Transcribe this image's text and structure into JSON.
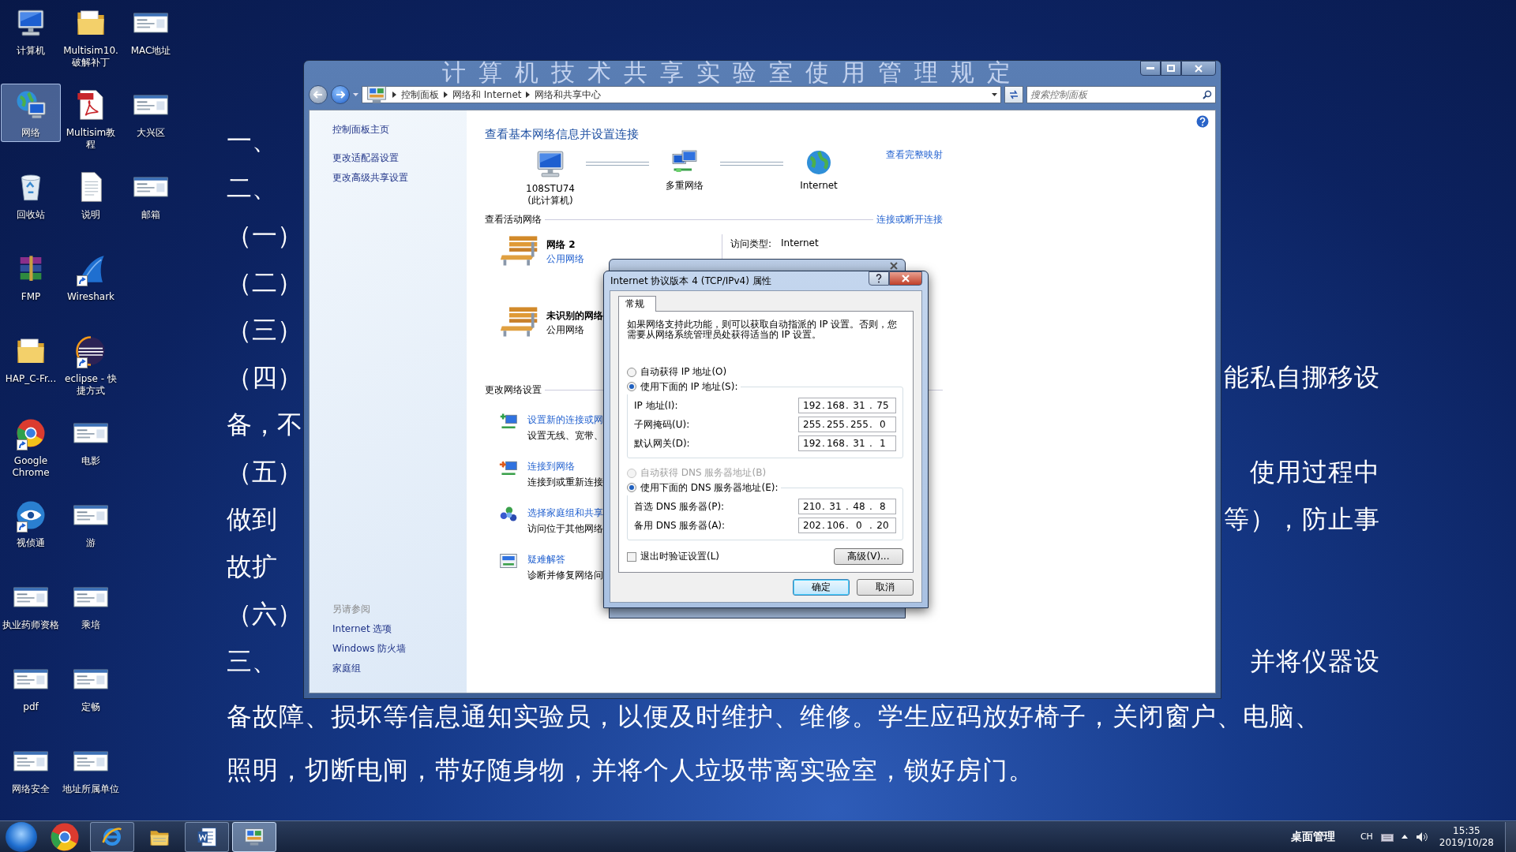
{
  "desktop_icons": [
    {
      "label": "计算机",
      "kind": "computer",
      "shortcut": false,
      "selected": false
    },
    {
      "label": "网络",
      "kind": "network",
      "shortcut": false,
      "selected": true
    },
    {
      "label": "回收站",
      "kind": "recycle",
      "shortcut": false,
      "selected": false
    },
    {
      "label": "FMP",
      "kind": "archive",
      "shortcut": false,
      "selected": false
    },
    {
      "label": "HAP_C-Fr...",
      "kind": "folder",
      "shortcut": false,
      "selected": false
    },
    {
      "label": "Google Chrome",
      "kind": "chrome",
      "shortcut": true,
      "selected": false
    },
    {
      "label": "视侦通",
      "kind": "eye",
      "shortcut": true,
      "selected": false
    },
    {
      "label": "执业药师资格",
      "kind": "thumbnail",
      "shortcut": false,
      "selected": false
    },
    {
      "label": "pdf",
      "kind": "thumbnail",
      "shortcut": false,
      "selected": false
    },
    {
      "label": "网络安全",
      "kind": "thumbnail",
      "shortcut": false,
      "selected": false
    },
    {
      "label": "Multisim10.破解补丁",
      "kind": "folder",
      "shortcut": false,
      "selected": false
    },
    {
      "label": "Multisim教程",
      "kind": "pdf",
      "shortcut": false,
      "selected": false
    },
    {
      "label": "说明",
      "kind": "document",
      "shortcut": false,
      "selected": false
    },
    {
      "label": "Wireshark",
      "kind": "shark",
      "shortcut": true,
      "selected": false
    },
    {
      "label": "eclipse - 快捷方式",
      "kind": "eclipse",
      "shortcut": true,
      "selected": false
    },
    {
      "label": "电影",
      "kind": "thumbnail",
      "shortcut": false,
      "selected": false
    },
    {
      "label": "游",
      "kind": "thumbnail",
      "shortcut": false,
      "selected": false
    },
    {
      "label": "乘培",
      "kind": "thumbnail",
      "shortcut": false,
      "selected": false
    },
    {
      "label": "定畅",
      "kind": "thumbnail",
      "shortcut": false,
      "selected": false
    },
    {
      "label": "地址所属单位",
      "kind": "thumbnail",
      "shortcut": false,
      "selected": false
    },
    {
      "label": "MAC地址",
      "kind": "thumbnail",
      "shortcut": false,
      "selected": false
    },
    {
      "label": "大兴区",
      "kind": "thumbnail",
      "shortcut": false,
      "selected": false
    },
    {
      "label": "邮箱",
      "kind": "thumbnail",
      "shortcut": false,
      "selected": false
    }
  ],
  "slide": {
    "title": "计算机技术共享实验室使用管理规定",
    "lines": [
      {
        "left": "一、"
      },
      {
        "left": "二、"
      },
      {
        "left": "（一）"
      },
      {
        "left": "（二）"
      },
      {
        "left": "（三）"
      },
      {
        "left": "（四）",
        "right": "能私自挪移设"
      },
      {
        "left": "备，不"
      },
      {
        "left": "（五）",
        "right": "使用过程中"
      },
      {
        "left": "做到",
        "right": "等），防止事"
      },
      {
        "left": "故扩"
      },
      {
        "left": "（六）"
      },
      {
        "left": "三、",
        "right": "并将仪器设"
      },
      {
        "full": "备故障、损坏等信息通知实验员，以便及时维护、维修。学生应码放好椅子，关闭窗户、电脑、"
      },
      {
        "full": "照明，切断电闸，带好随身物，并将个人垃圾带离实验室，锁好房门。"
      }
    ]
  },
  "control_panel": {
    "breadcrumbs": [
      "控制面板",
      "网络和 Internet",
      "网络和共享中心"
    ],
    "search": {
      "placeholder": "搜索控制面板"
    },
    "sidebar": {
      "items": [
        "控制面板主页",
        "更改适配器设置",
        "更改高级共享设置"
      ],
      "see_also_heading": "另请参阅",
      "see_also": [
        "Internet 选项",
        "Windows 防火墙",
        "家庭组"
      ]
    },
    "heading": "查看基本网络信息并设置连接",
    "map": {
      "nodes": [
        {
          "kind": "computer",
          "label": "108STU74",
          "sublabel": "(此计算机)"
        },
        {
          "kind": "multi",
          "label": "多重网络"
        },
        {
          "kind": "globe",
          "label": "Internet"
        }
      ],
      "link": "查看完整映射"
    },
    "active_networks": {
      "heading": "查看活动网络",
      "link": "连接或断开连接",
      "networks": [
        {
          "name": "网络 2",
          "category": "公用网络",
          "category_link": true,
          "access_label": "访问类型:",
          "access_value": "Internet"
        },
        {
          "name": "未识别的网络",
          "category": "公用网络",
          "category_link": false
        }
      ]
    },
    "change_settings": {
      "heading": "更改网络设置",
      "tasks": [
        {
          "kind": "new",
          "link": "设置新的连接或网",
          "description": "设置无线、宽带、"
        },
        {
          "kind": "connect",
          "link": "连接到网络",
          "description": "连接到或重新连接"
        },
        {
          "kind": "homegroup",
          "link": "选择家庭组和共享",
          "description": "访问位于其他网络"
        },
        {
          "kind": "troubleshoot",
          "link": "疑难解答",
          "description": "诊断并修复网络问"
        }
      ]
    }
  },
  "dialog": {
    "title": "Internet 协议版本 4 (TCP/IPv4) 属性",
    "tabs": [
      {
        "label": "常规",
        "selected": true
      }
    ],
    "intro": "如果网络支持此功能，则可以获取自动指派的 IP 设置。否则，您需要从网络系统管理员处获得适当的 IP 设置。",
    "octet_separator": ".",
    "groups": [
      {
        "options": [
          {
            "label": "自动获得 IP 地址(O)",
            "selected": false,
            "disabled": false
          },
          {
            "label": "使用下面的 IP 地址(S):",
            "selected": true,
            "disabled": false
          }
        ],
        "fields": [
          {
            "label": "IP 地址(I):",
            "octets": [
              "192",
              "168",
              "31",
              "75"
            ]
          },
          {
            "label": "子网掩码(U):",
            "octets": [
              "255",
              "255",
              "255",
              "0"
            ]
          },
          {
            "label": "默认网关(D):",
            "octets": [
              "192",
              "168",
              "31",
              "1"
            ]
          }
        ]
      },
      {
        "options": [
          {
            "label": "自动获得 DNS 服务器地址(B)",
            "selected": false,
            "disabled": true
          },
          {
            "label": "使用下面的 DNS 服务器地址(E):",
            "selected": true,
            "disabled": false
          }
        ],
        "fields": [
          {
            "label": "首选 DNS 服务器(P):",
            "octets": [
              "210",
              "31",
              "48",
              "8"
            ]
          },
          {
            "label": "备用 DNS 服务器(A):",
            "octets": [
              "202",
              "106",
              "0",
              "20"
            ]
          }
        ]
      }
    ],
    "checkbox": {
      "label": "退出时验证设置(L)",
      "checked": false
    },
    "advanced_button": "高级(V)...",
    "buttons": [
      {
        "label": "确定",
        "default": true
      },
      {
        "label": "取消",
        "default": false
      }
    ]
  },
  "taskbar": {
    "apps": [
      {
        "kind": "chrome",
        "running": false,
        "selected": false
      },
      {
        "kind": "ie",
        "running": true,
        "selected": false
      },
      {
        "kind": "explorer",
        "running": false,
        "selected": false
      },
      {
        "kind": "word",
        "running": true,
        "selected": false
      },
      {
        "kind": "control-panel",
        "running": true,
        "selected": true
      }
    ],
    "toolbar_label": "桌面管理",
    "language": "CH",
    "time": "15:35",
    "date": "2019/10/28"
  }
}
